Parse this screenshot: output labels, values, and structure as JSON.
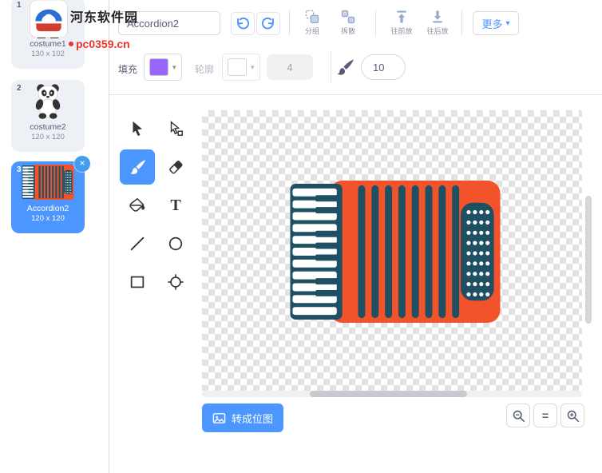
{
  "colors": {
    "accent": "#4C97FF",
    "fill_swatch": "#9966FF",
    "accordion_body": "#F2532B",
    "accordion_dark": "#1E4F63",
    "selected_card": "#4C97FF"
  },
  "watermark": {
    "site_name": "河东软件园",
    "site_url": "pc0359.cn"
  },
  "header": {
    "costume_name": "Accordion2",
    "group": "分组",
    "ungroup": "拆散",
    "bring_forward": "往前放",
    "send_backward": "往后放",
    "more": "更多",
    "more_caret": "▾"
  },
  "style_bar": {
    "fill_label": "填充",
    "outline_label": "轮廓",
    "outline_width": "4",
    "brush_size": "10",
    "swatch_caret": "▾"
  },
  "costumes": [
    {
      "number": "1",
      "name": "costume1",
      "size": "130 x 102"
    },
    {
      "number": "2",
      "name": "costume2",
      "size": "120 x 120"
    },
    {
      "number": "3",
      "name": "Accordion2",
      "size": "120 x 120"
    }
  ],
  "delete_glyph": "×",
  "text_tool_glyph": "T",
  "canvas_footer": {
    "convert_to_bitmap": "转成位图"
  },
  "zoom": {
    "out": "−",
    "reset": "=",
    "in": "+"
  },
  "tools": [
    "select",
    "reshape",
    "brush",
    "eraser",
    "fill",
    "text",
    "line",
    "circle",
    "rectangle",
    "center"
  ]
}
